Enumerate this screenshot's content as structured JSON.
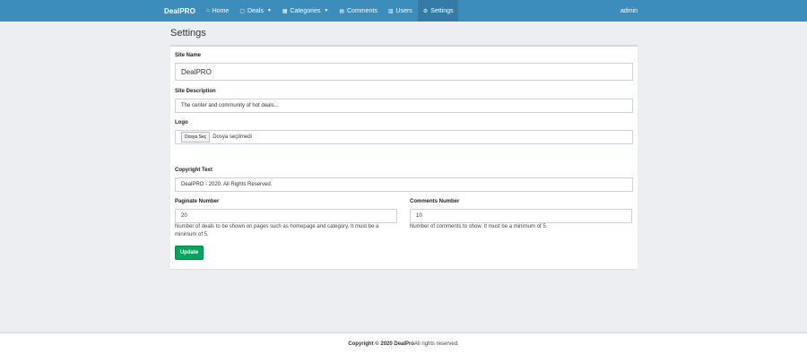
{
  "nav": {
    "brand_bold": "Deal",
    "brand_rest": "PRO",
    "items": [
      {
        "label": "Home",
        "icon": "⌂",
        "caret": false
      },
      {
        "label": "Deals",
        "icon": "▢",
        "caret": true
      },
      {
        "label": "Categories",
        "icon": "▦",
        "caret": true
      },
      {
        "label": "Comments",
        "icon": "▤",
        "caret": false
      },
      {
        "label": "Users",
        "icon": "▥",
        "caret": false
      },
      {
        "label": "Settings",
        "icon": "⚙",
        "caret": false
      }
    ],
    "user": "admin"
  },
  "page": {
    "title": "Settings"
  },
  "form": {
    "site_name_label": "Site Name",
    "site_name_value": "DealPRO",
    "site_desc_label": "Site Description",
    "site_desc_value": "The center and community of hot deals...",
    "logo_label": "Logo",
    "file_button": "Dosya Seç",
    "file_status": "Dosya seçilmedi",
    "copyright_label": "Copyright Text",
    "copyright_value": "DealPRO - 2020. All Rights Reserved.",
    "paginate_label": "Paginate Number",
    "paginate_value": "20",
    "paginate_help": "Number of deals to be shown on pages such as homepage and category. It must be a minimum of 5.",
    "comments_label": "Comments Number",
    "comments_value": "10",
    "comments_help": "Number of comments to show. It must be a minimum of 5.",
    "update_button": "Update"
  },
  "footer": {
    "prefix": "Copyright © 2020 DealPro",
    "suffix": " All rights reserved."
  },
  "colors": {
    "navbar": "#3c8dbc",
    "update_button": "#00a65a",
    "background": "#eceef2"
  }
}
